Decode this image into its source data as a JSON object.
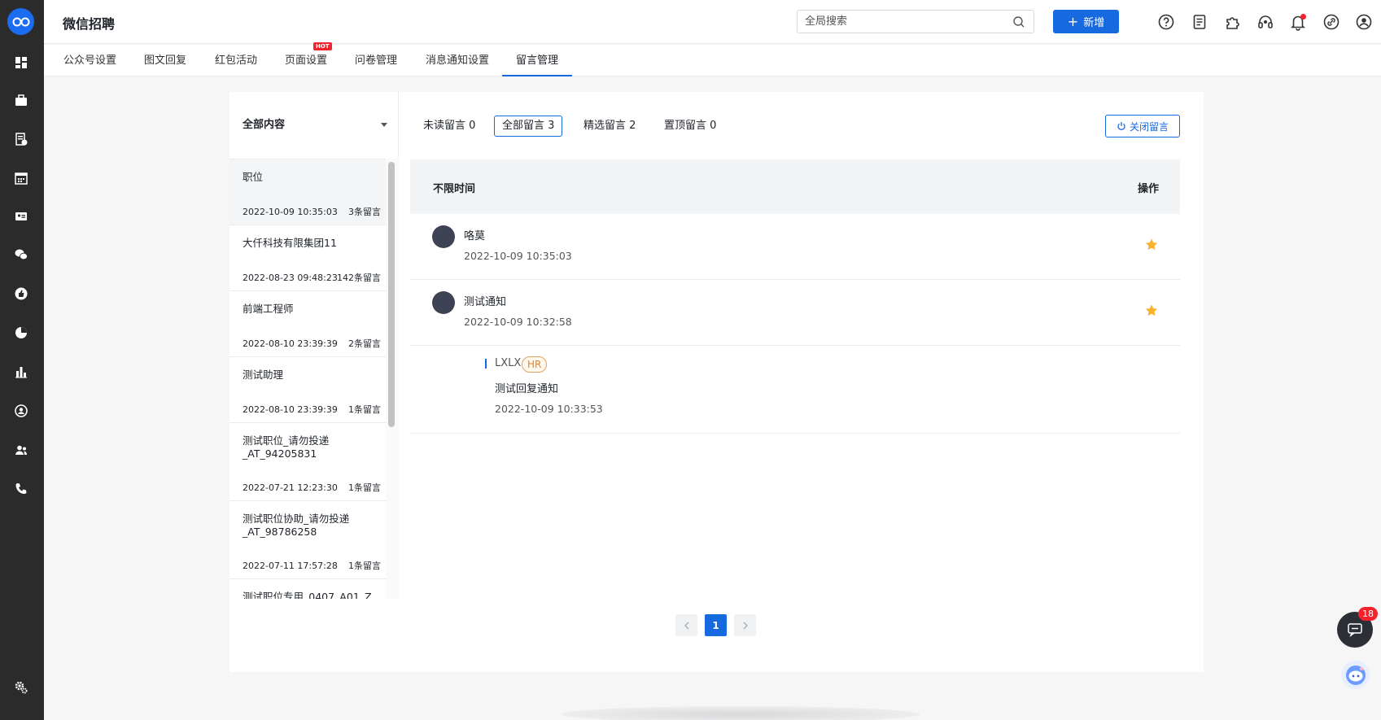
{
  "app": {
    "title": "微信招聘"
  },
  "topbar": {
    "search_placeholder": "全局搜索",
    "new_button_label": "新增",
    "icons": [
      "help-icon",
      "document-icon",
      "plugin-icon",
      "headset-icon",
      "bell-icon",
      "link-icon",
      "user-icon"
    ]
  },
  "sidebar": {
    "icons": [
      "dashboard-icon",
      "briefcase-icon",
      "resume-icon",
      "calendar-icon",
      "id-card-icon",
      "wechat-icon",
      "thumb-up-icon",
      "pie-chart-icon",
      "bar-chart-icon",
      "user-circle-icon",
      "team-icon",
      "phone-icon",
      "settings-icon"
    ]
  },
  "tabs": [
    {
      "label": "公众号设置"
    },
    {
      "label": "图文回复"
    },
    {
      "label": "红包活动"
    },
    {
      "label": "页面设置",
      "badge": "HOT"
    },
    {
      "label": "问卷管理"
    },
    {
      "label": "消息通知设置"
    },
    {
      "label": "留言管理",
      "active": true
    }
  ],
  "filter": {
    "label": "全部内容"
  },
  "jobs": [
    {
      "name": "职位",
      "date": "2022-10-09 10:35:03",
      "count": "3条留言",
      "selected": true
    },
    {
      "name": "大仟科技有限集团11",
      "date": "2022-08-23 09:48:23",
      "count": "142条留言"
    },
    {
      "name": "前端工程师",
      "date": "2022-08-10 23:39:39",
      "count": "2条留言"
    },
    {
      "name": "测试助理",
      "date": "2022-08-10 23:39:39",
      "count": "1条留言"
    },
    {
      "name": "测试职位_请勿投递_AT_94205831",
      "date": "2022-07-21 12:23:30",
      "count": "1条留言"
    },
    {
      "name": "测试职位协助_请勿投递_AT_98786258",
      "date": "2022-07-11 17:57:28",
      "count": "1条留言"
    },
    {
      "name": "测试职位专用_0407_A01_Z",
      "date": "",
      "count": ""
    }
  ],
  "stat_tabs": [
    {
      "label": "未读留言 0"
    },
    {
      "label": "全部留言 3",
      "active": true
    },
    {
      "label": "精选留言 2"
    },
    {
      "label": "置顶留言 0"
    }
  ],
  "close_button_label": "关闭留言",
  "table": {
    "time_header": "不限时间",
    "action_header": "操作"
  },
  "messages": [
    {
      "name": "咯莫",
      "time": "2022-10-09 10:35:03",
      "featured": true
    },
    {
      "name": "测试通知",
      "time": "2022-10-09 10:32:58",
      "featured": true
    }
  ],
  "reply": {
    "name": "LXLX",
    "tag": "HR",
    "text": "测试回复通知",
    "time": "2022-10-09 10:33:53"
  },
  "pagination": {
    "current": "1"
  },
  "chat": {
    "badge": "18"
  },
  "colors": {
    "primary": "#1769e0",
    "sidebar": "#2b2b2b",
    "star": "#f7b32b",
    "hot": "#f5222d"
  }
}
